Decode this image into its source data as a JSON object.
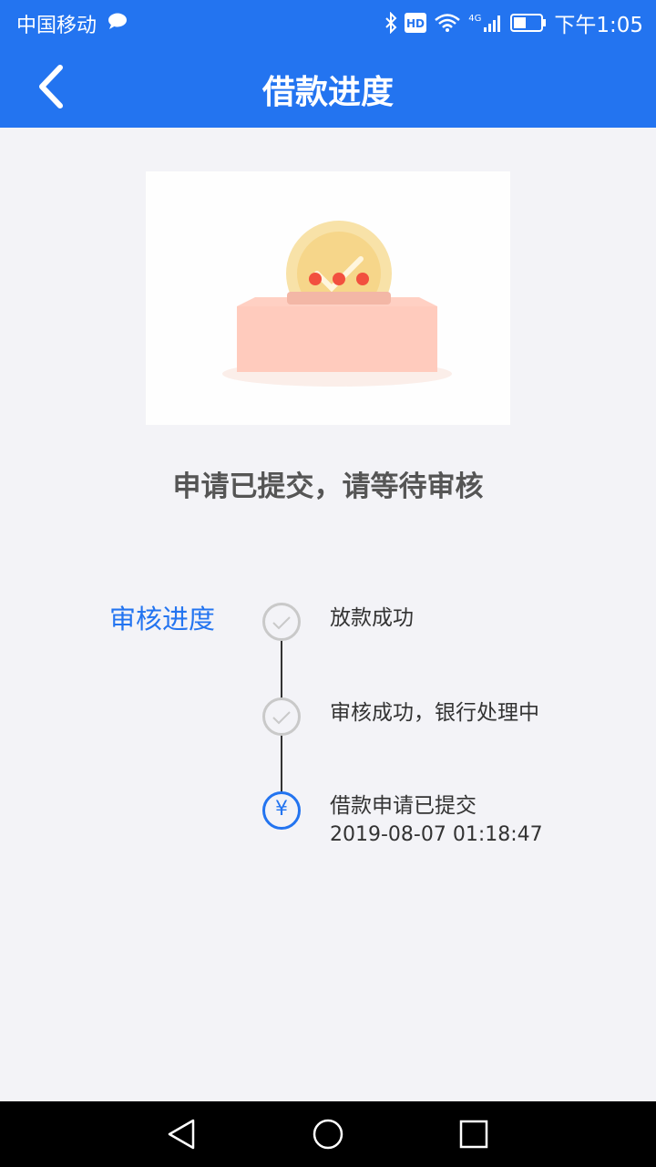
{
  "status_bar": {
    "carrier": "中国移动",
    "network": "4G",
    "time": "下午1:05"
  },
  "header": {
    "title": "借款进度"
  },
  "status_message": "申请已提交，请等待审核",
  "progress": {
    "label": "审核进度",
    "steps": [
      {
        "text": "放款成功",
        "state": "pending"
      },
      {
        "text": "审核成功，银行处理中",
        "state": "pending"
      },
      {
        "text": "借款申请已提交",
        "time": "2019-08-07 01:18:47",
        "state": "current",
        "icon_text": "¥"
      }
    ]
  },
  "colors": {
    "primary": "#2374f0",
    "background": "#f3f3f7",
    "node_done": "#c9c9c9"
  }
}
